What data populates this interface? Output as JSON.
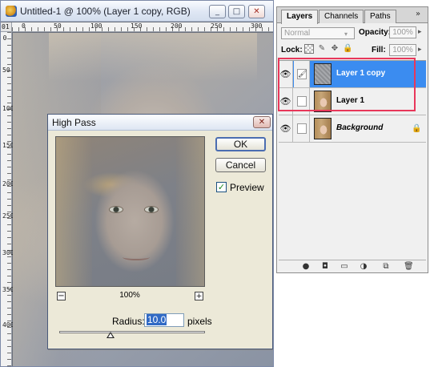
{
  "document_window": {
    "title": "Untitled-1 @ 100% (Layer 1 copy, RGB)",
    "buttons": {
      "minimize": "_",
      "maximize": "□",
      "close": "✕"
    },
    "ruler_top": {
      "corner": "01",
      "labels": [
        "0",
        "50",
        "100",
        "150",
        "200",
        "250",
        "300"
      ]
    },
    "ruler_left": {
      "labels": [
        "0",
        "50",
        "100",
        "150",
        "200",
        "250",
        "300",
        "350",
        "400"
      ]
    }
  },
  "high_pass_dialog": {
    "title": "High Pass",
    "close": "✕",
    "ok_label": "OK",
    "cancel_label": "Cancel",
    "preview_label": "Preview",
    "preview_checked": "✓",
    "zoom_level": "100%",
    "zoom_out": "−",
    "zoom_in": "+",
    "radius_label": "Radius:",
    "radius_value": "10.0",
    "radius_unit": "pixels",
    "radius_slider_fraction": 0.35
  },
  "layers_panel": {
    "tabs": [
      "Layers",
      "Channels",
      "Paths"
    ],
    "menu": "»",
    "blend_mode": "Normal",
    "blend_arrow": "▾",
    "opacity_label": "Opacity:",
    "opacity_value": "100%",
    "lock_label": "Lock:",
    "fill_label": "Fill:",
    "fill_value": "100%",
    "spin_arrow": "▸",
    "lock_icons": {
      "image": "✎",
      "position": "✥",
      "all": "🔒"
    },
    "layers": [
      {
        "name": "Layer 1 copy",
        "eye": "👁",
        "link": "🖌",
        "selected": true,
        "italic": false,
        "thumb": "gray"
      },
      {
        "name": "Layer 1",
        "eye": "👁",
        "link": "",
        "selected": false,
        "italic": false,
        "thumb": "face"
      },
      {
        "name": "Background",
        "eye": "👁",
        "link": "",
        "selected": false,
        "italic": true,
        "thumb": "face",
        "lock": "🔒"
      }
    ],
    "footer_icons": [
      "●",
      "◘",
      "▭",
      "◑",
      "⧉",
      "🗑"
    ],
    "highlight_color": "#e8375a",
    "selected_color": "#3b8cf0"
  }
}
